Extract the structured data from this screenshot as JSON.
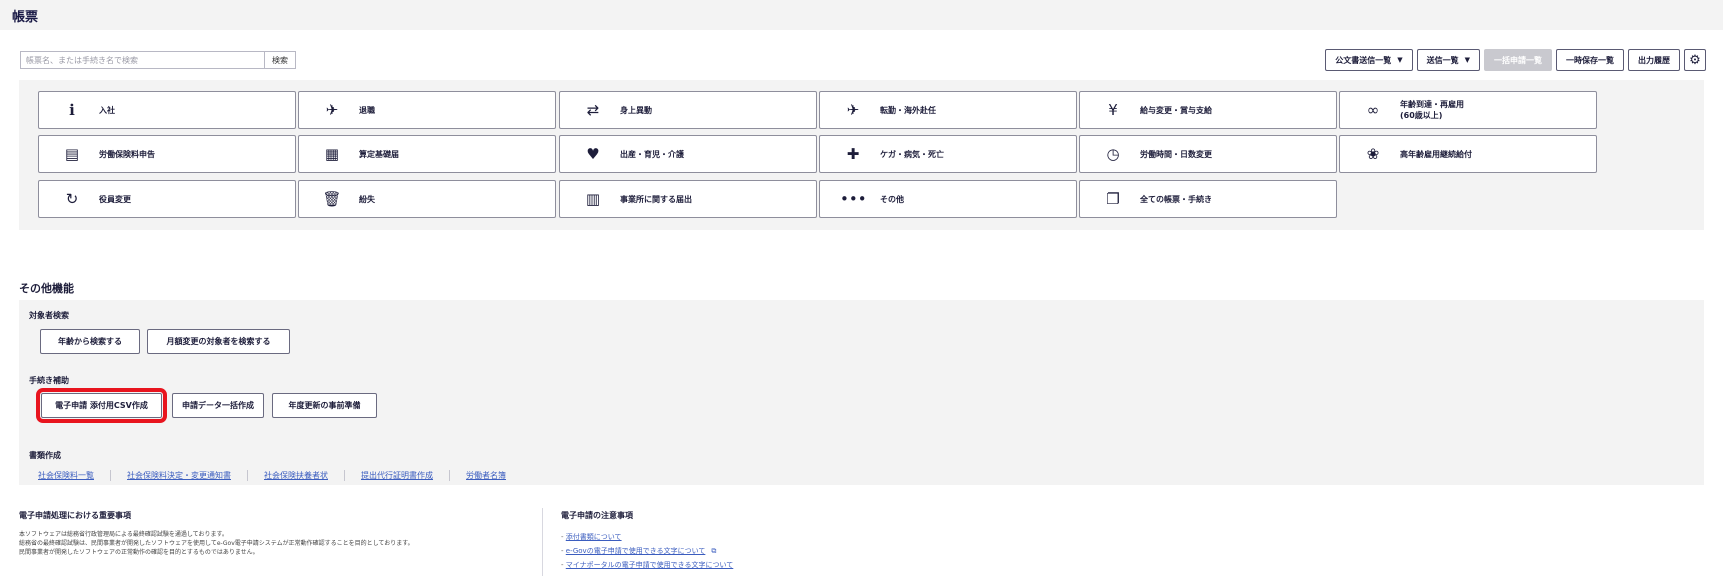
{
  "header": {
    "title": "帳票"
  },
  "search": {
    "placeholder": "帳票名、または手続き名で検索",
    "button_label": "検索"
  },
  "toolbar": {
    "official_docs_label": "公文書送信一覧",
    "sent_list_label": "送信一覧",
    "bulk_apply_label": "一括申請一覧",
    "temp_saved_label": "一時保存一覧",
    "output_history_label": "出力履歴"
  },
  "form_cards": [
    {
      "label": "入社",
      "icon": "info-icon",
      "glyph": "ℹ"
    },
    {
      "label": "退職",
      "icon": "farewell-icon",
      "glyph": "✈"
    },
    {
      "label": "身上異動",
      "icon": "person-change-icon",
      "glyph": "⇄"
    },
    {
      "label": "転勤・海外赴任",
      "icon": "airplane-icon",
      "glyph": "✈"
    },
    {
      "label": "給与変更・賞与支給",
      "icon": "payment-icon",
      "glyph": "¥"
    },
    {
      "label": "年齢到達・再雇用\n(60歳以上)",
      "icon": "glasses-icon",
      "glyph": "∞"
    },
    {
      "label": "労働保険料申告",
      "icon": "document-icon",
      "glyph": "▤"
    },
    {
      "label": "算定基礎届",
      "icon": "calculator-icon",
      "glyph": "▦"
    },
    {
      "label": "出産・育児・介護",
      "icon": "heart-icon",
      "glyph": "♥"
    },
    {
      "label": "ケガ・病気・死亡",
      "icon": "first-aid-icon",
      "glyph": "✚"
    },
    {
      "label": "労働時間・日数変更",
      "icon": "clock-icon",
      "glyph": "◷"
    },
    {
      "label": "高年齢雇用継続給付",
      "icon": "leaf-icon",
      "glyph": "❀"
    },
    {
      "label": "役員変更",
      "icon": "refresh-icon",
      "glyph": "↻"
    },
    {
      "label": "紛失",
      "icon": "trash-icon",
      "glyph": "🗑"
    },
    {
      "label": "事業所に関する届出",
      "icon": "building-icon",
      "glyph": "▥"
    },
    {
      "label": "その他",
      "icon": "more-icon",
      "glyph": "•••"
    },
    {
      "label": "全ての帳票・手続き",
      "icon": "documents-icon",
      "glyph": "❐"
    }
  ],
  "other": {
    "title": "その他機能",
    "target_search": {
      "title": "対象者検索",
      "buttons": [
        "年齢から検索する",
        "月額変更の対象者を検索する"
      ]
    },
    "procedure_support": {
      "title": "手続き補助",
      "buttons": [
        "電子申請 添付用CSV作成",
        "申請データ一括作成",
        "年度更新の事前準備"
      ]
    },
    "document_creation": {
      "title": "書類作成",
      "links": [
        "社会保険料一覧",
        "社会保険料決定・変更通知書",
        "社会保険扶養者状",
        "提出代行証明書作成",
        "労働者名簿"
      ]
    }
  },
  "notices": {
    "left": {
      "title": "電子申請処理における重要事項",
      "lines": [
        "本ソフトウェアは総務省行政管理局による最終確認試験を通過しております。",
        "総務省の最終確認試験は、民間事業者が開発したソフトウェアを使用してe-Gov電子申請システムが正常動作確認することを目的としております。",
        "民間事業者が開発したソフトウェアの正常動作の確認を目的とするものではありません。"
      ]
    },
    "right": {
      "title": "電子申請の注意事項",
      "links": [
        "添付書類について",
        "e-Govの電子申請で使用できる文字について",
        "マイナポータルの電子申請で使用できる文字について"
      ]
    }
  }
}
